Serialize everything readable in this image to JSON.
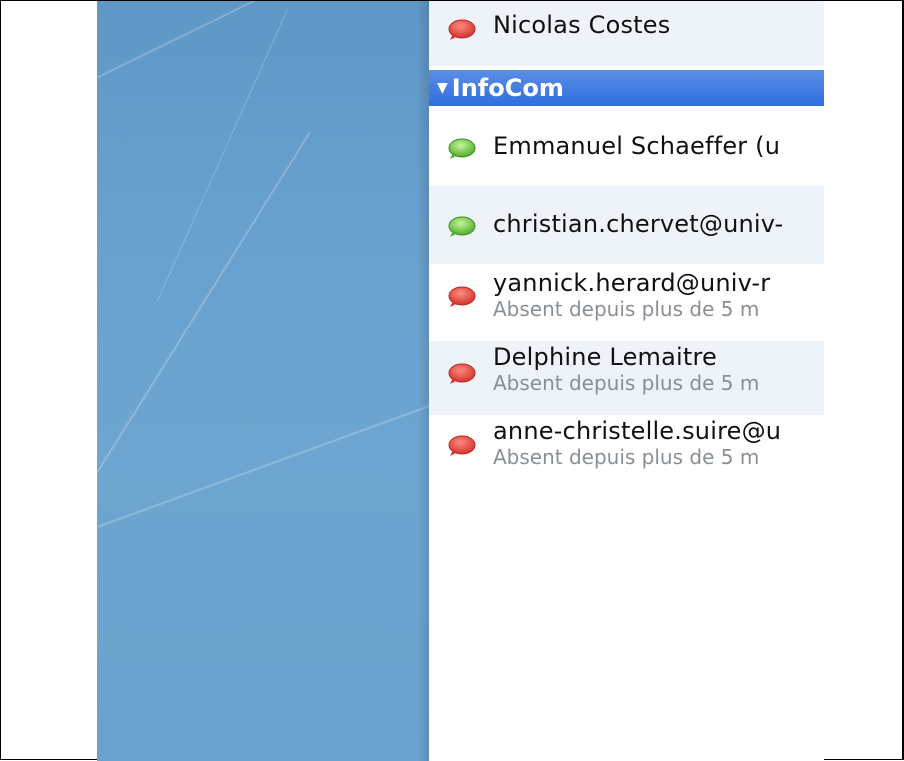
{
  "window": {
    "title": ""
  },
  "contacts_top": [
    {
      "name": "Nicolas Costes",
      "status": "",
      "state": "away"
    }
  ],
  "group": {
    "label": "InfoCom",
    "expanded": true
  },
  "group_contacts": [
    {
      "name": "Emmanuel Schaeffer (u",
      "status": "",
      "state": "available"
    },
    {
      "name": "christian.chervet@univ-",
      "status": "",
      "state": "available"
    },
    {
      "name": "yannick.herard@univ-r",
      "status": "Absent depuis plus de 5 m",
      "state": "away"
    },
    {
      "name": "Delphine Lemaitre",
      "status": "Absent depuis plus de 5 m",
      "state": "away"
    },
    {
      "name": "anne-christelle.suire@u",
      "status": "Absent depuis plus de 5 m",
      "state": "away"
    }
  ],
  "icons": {
    "available": "green-bubble-icon",
    "away": "red-bubble-icon"
  },
  "colors": {
    "available": "#5cc13a",
    "away": "#e0443a",
    "group_header": "#3b78e0",
    "desktop": "#6aa2cf"
  }
}
